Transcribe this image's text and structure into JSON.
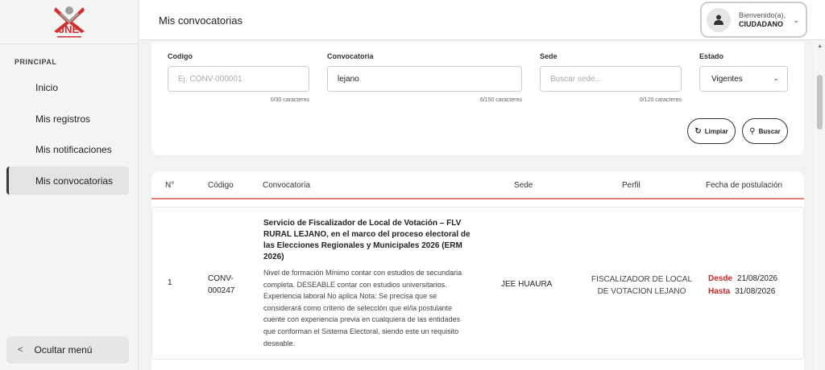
{
  "sidebar": {
    "logo_text": "JNE",
    "section": "PRINCIPAL",
    "items": [
      {
        "label": "Inicio"
      },
      {
        "label": "Mis registros"
      },
      {
        "label": "Mis notificaciones"
      },
      {
        "label": "Mis convocatorias"
      }
    ],
    "hide_menu": "Ocultar menú"
  },
  "header": {
    "title": "Mis convocatorias",
    "welcome": "Bienvenido(a),",
    "user": "CIUDADANO"
  },
  "filters": {
    "codigo": {
      "label": "Codigo",
      "placeholder": "Ej. CONV-000001",
      "value": "",
      "count": "0/30 caracteres"
    },
    "convocatoria": {
      "label": "Convocatoria",
      "placeholder": "",
      "value": "lejano",
      "count": "6/150 caracteres"
    },
    "sede": {
      "label": "Sede",
      "placeholder": "Buscar sede...",
      "value": "",
      "count": "0/120 caracteres"
    },
    "estado": {
      "label": "Estado",
      "selected": "Vigentes"
    },
    "clear_label": "Limpiar",
    "search_label": "Buscar"
  },
  "table": {
    "headers": {
      "num": "N°",
      "codigo": "Código",
      "convocatoria": "Convocatoria",
      "sede": "Sede",
      "perfil": "Perfil",
      "fecha": "Fecha de postulación"
    },
    "rows": [
      {
        "num": "1",
        "codigo_line1": "CONV-",
        "codigo_line2": "000247",
        "title": "Servicio de Fiscalizador de Local de Votación – FLV RURAL LEJANO, en el marco del proceso electoral de las Elecciones Regionales y Municipales 2026 (ERM 2026)",
        "description": "Nivel de formación Mínimo contar con estudios de secundaria completa. DESEABLE contar con estudios universitarios. Experiencia laboral No aplica Nota: Se precisa que se considerará como criterio de selección que el/la postulante cuente con experiencia previa en cualquiera de las entidades que conforman el Sistema Electoral, siendo este un requisito deseable.",
        "sede": "JEE HUAURA",
        "perfil_line1": "FISCALIZADOR DE LOCAL",
        "perfil_line2": "DE VOTACION LEJANO",
        "desde_label": "Desde",
        "desde": "21/08/2026",
        "hasta_label": "Hasta",
        "hasta": "31/08/2026"
      }
    ]
  },
  "colors": {
    "accent_red": "#c62828",
    "logo_red": "#d32f2f"
  }
}
